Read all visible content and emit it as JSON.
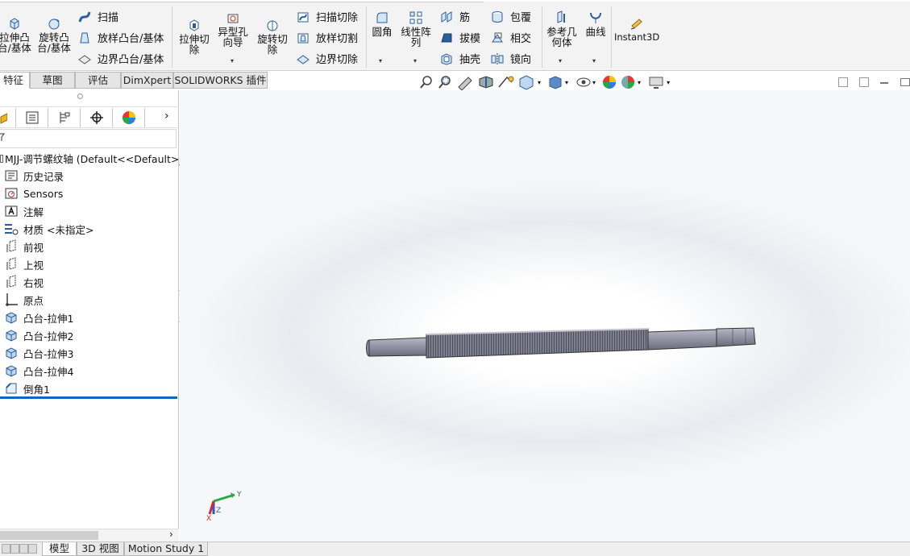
{
  "ribbon": {
    "extrude_boss": "拉伸凸\n台/基体",
    "revolve_boss": "旋转凸\n台/基体",
    "sweep": "扫描",
    "loft_boss": "放样凸台/基体",
    "boundary_boss": "边界凸台/基体",
    "extrude_cut": "拉伸切\n除",
    "hole_wizard": "异型孔\n向导",
    "revolve_cut": "旋转切\n除",
    "sweep_cut": "扫描切除",
    "loft_cut": "放样切割",
    "boundary_cut": "边界切除",
    "fillet": "圆角",
    "linear_pattern": "线性阵\n列",
    "rib": "筋",
    "draft": "拔模",
    "shell": "抽壳",
    "wrap": "包覆",
    "intersect": "相交",
    "mirror": "镜向",
    "ref_geometry": "参考几\n何体",
    "curves": "曲线",
    "instant3d": "Instant3D"
  },
  "tabs": [
    {
      "label": "特征"
    },
    {
      "label": "草图"
    },
    {
      "label": "评估"
    },
    {
      "label": "DimXpert"
    },
    {
      "label": "SOLIDWORKS 插件"
    }
  ],
  "tree": {
    "root": "MJJ-调节螺纹轴  (Default<<Default>_",
    "items": [
      {
        "label": "历史记录",
        "icon": "history-icon"
      },
      {
        "label": "Sensors",
        "icon": "sensors-icon"
      },
      {
        "label": "注解",
        "icon": "annotations-icon"
      },
      {
        "label": "材质 <未指定>",
        "icon": "material-icon"
      },
      {
        "label": "前视",
        "icon": "plane-icon"
      },
      {
        "label": "上视",
        "icon": "plane-icon"
      },
      {
        "label": "右视",
        "icon": "plane-icon"
      },
      {
        "label": "原点",
        "icon": "origin-icon"
      },
      {
        "label": "凸台-拉伸1",
        "icon": "extrude-feature-icon"
      },
      {
        "label": "凸台-拉伸2",
        "icon": "extrude-feature-icon"
      },
      {
        "label": "凸台-拉伸3",
        "icon": "extrude-feature-icon"
      },
      {
        "label": "凸台-拉伸4",
        "icon": "extrude-feature-icon"
      },
      {
        "label": "倒角1",
        "icon": "chamfer-icon"
      }
    ]
  },
  "triad": {
    "y_label": "Y",
    "x_label": "X",
    "z_label": "Z"
  },
  "bottom_tabs": [
    {
      "label": "模型"
    },
    {
      "label": "3D 视图"
    },
    {
      "label": "Motion Study 1"
    }
  ],
  "colors": {
    "accent": "#1565c0",
    "model": "#8b8c9a",
    "thread": "#6e6f7d"
  }
}
